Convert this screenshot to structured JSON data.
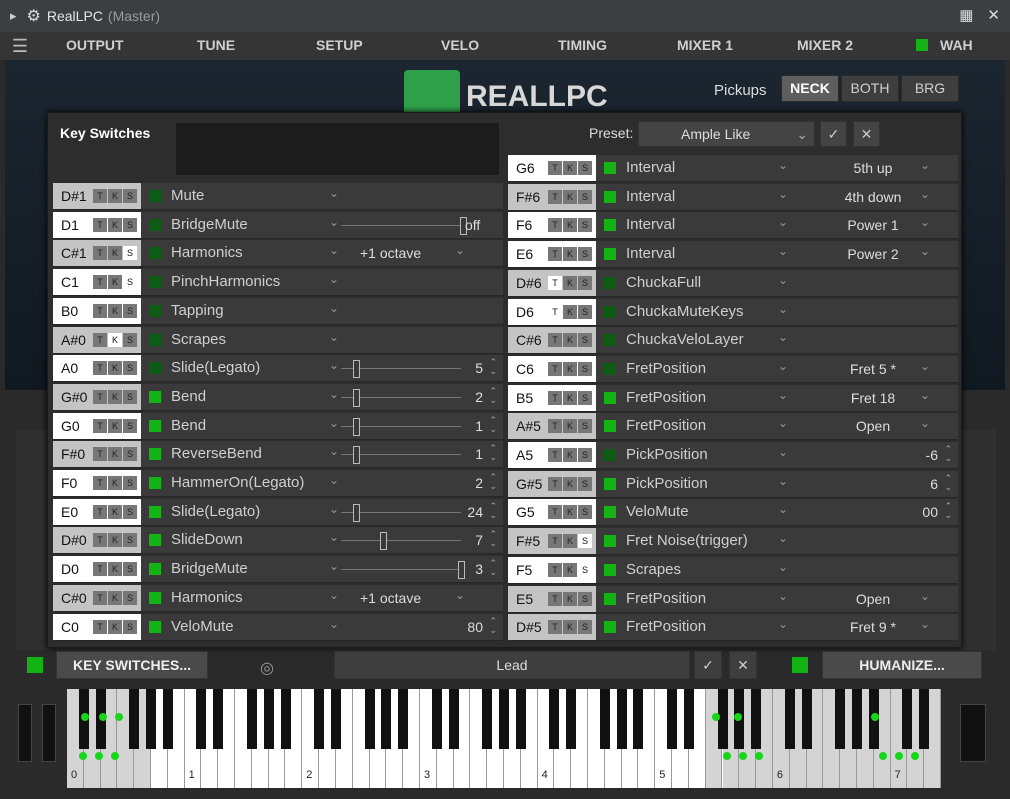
{
  "window": {
    "title": "RealLPC",
    "subtitle": "(Master)"
  },
  "menu": [
    "OUTPUT",
    "TUNE",
    "SETUP",
    "VELO",
    "TIMING",
    "MIXER 1",
    "MIXER 2",
    "WAH"
  ],
  "brand": "REALLPC",
  "pickups": {
    "label": "Pickups",
    "options": [
      "NECK",
      "BOTH",
      "BRG"
    ],
    "selected": "NECK"
  },
  "panel": {
    "title": "Key Switches",
    "preset_label": "Preset:",
    "preset_value": "Ample Like",
    "tks": [
      "T",
      "K",
      "S"
    ]
  },
  "left_rows": [
    {
      "note": "D#1",
      "label": "Mute",
      "val": ""
    },
    {
      "note": "D1",
      "label": "BridgeMute",
      "val": "off"
    },
    {
      "note": "C#1",
      "label": "Harmonics",
      "val": "+1 octave"
    },
    {
      "note": "C1",
      "label": "PinchHarmonics",
      "val": ""
    },
    {
      "note": "B0",
      "label": "Tapping",
      "val": ""
    },
    {
      "note": "A#0",
      "label": "Scrapes",
      "val": ""
    },
    {
      "note": "A0",
      "label": "Slide(Legato)",
      "val": "5"
    },
    {
      "note": "G#0",
      "label": "Bend",
      "val": "2"
    },
    {
      "note": "G0",
      "label": "Bend",
      "val": "1"
    },
    {
      "note": "F#0",
      "label": "ReverseBend",
      "val": "1"
    },
    {
      "note": "F0",
      "label": "HammerOn(Legato)",
      "val": "2"
    },
    {
      "note": "E0",
      "label": "Slide(Legato)",
      "val": "24"
    },
    {
      "note": "D#0",
      "label": "SlideDown",
      "val": "7"
    },
    {
      "note": "D0",
      "label": "BridgeMute",
      "val": "3"
    },
    {
      "note": "C#0",
      "label": "Harmonics",
      "val": "+1 octave"
    },
    {
      "note": "C0",
      "label": "VeloMute",
      "val": "80"
    }
  ],
  "right_rows": [
    {
      "note": "G6",
      "label": "Interval",
      "val": "5th up"
    },
    {
      "note": "F#6",
      "label": "Interval",
      "val": "4th down"
    },
    {
      "note": "F6",
      "label": "Interval",
      "val": "Power 1"
    },
    {
      "note": "E6",
      "label": "Interval",
      "val": "Power 2"
    },
    {
      "note": "D#6",
      "label": "ChuckaFull",
      "val": ""
    },
    {
      "note": "D6",
      "label": "ChuckaMuteKeys",
      "val": ""
    },
    {
      "note": "C#6",
      "label": "ChuckaVeloLayer",
      "val": ""
    },
    {
      "note": "C6",
      "label": "FretPosition",
      "val": "Fret 5   *"
    },
    {
      "note": "B5",
      "label": "FretPosition",
      "val": "Fret 18"
    },
    {
      "note": "A#5",
      "label": "FretPosition",
      "val": "Open"
    },
    {
      "note": "A5",
      "label": "PickPosition",
      "val": "-6"
    },
    {
      "note": "G#5",
      "label": "PickPosition",
      "val": "6"
    },
    {
      "note": "G5",
      "label": "VeloMute",
      "val": "00"
    },
    {
      "note": "F#5",
      "label": "Fret Noise(trigger)",
      "val": ""
    },
    {
      "note": "F5",
      "label": "Scrapes",
      "val": ""
    },
    {
      "note": "E5",
      "label": "FretPosition",
      "val": "Open"
    },
    {
      "note": "D#5",
      "label": "FretPosition",
      "val": "Fret 9   *"
    }
  ],
  "bottom": {
    "ks_button": "KEY SWITCHES...",
    "lead_value": "Lead",
    "humanize": "HUMANIZE..."
  },
  "keyboard": {
    "octaves": [
      "0",
      "1",
      "2",
      "3",
      "4",
      "5",
      "6",
      "7"
    ]
  }
}
